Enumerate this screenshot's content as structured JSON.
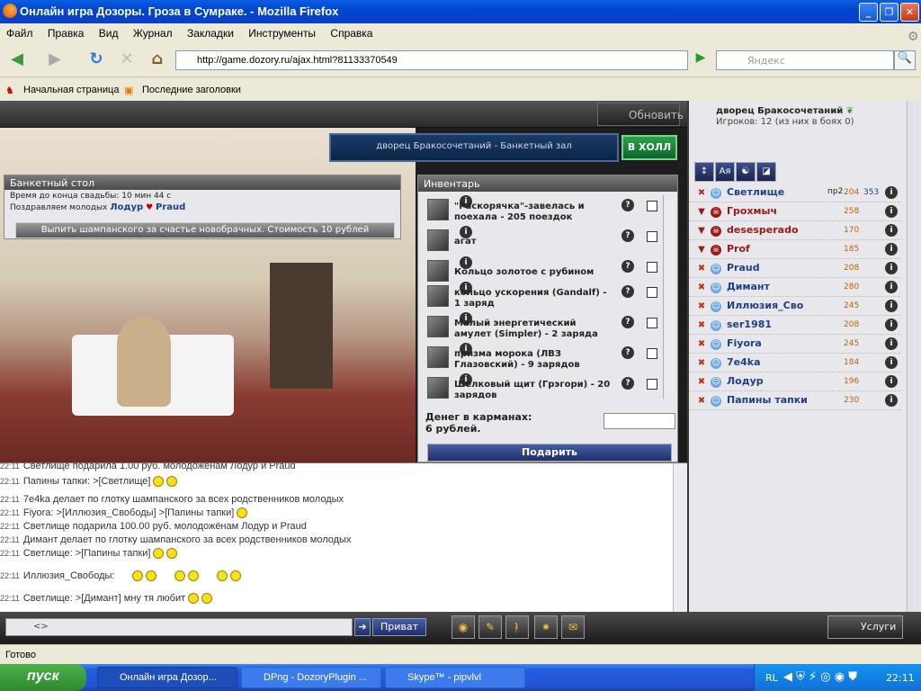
{
  "window": {
    "title": "Онлайн игра Дозоры. Гроза в Сумраке. - Mozilla Firefox"
  },
  "menu": [
    "Файл",
    "Правка",
    "Вид",
    "Журнал",
    "Закладки",
    "Инструменты",
    "Справка"
  ],
  "nav": {
    "url": "http://game.dozory.ru/ajax.html?81133370549",
    "search_placeholder": "Яндекс",
    "search_engine": "Я"
  },
  "bookmarks": [
    "Начальная страница",
    "Последние заголовки"
  ],
  "game": {
    "refresh_label": "Обновить",
    "room_title": "дворец Бракосочетаний - Банкетный зал",
    "to_hall": "В ХОЛЛ",
    "banquet": {
      "header": "Банкетный стол",
      "time_left": "Время до конца свадьбы: 10 мин 44 с",
      "congrats_prefix": "Поздравляем молодых",
      "groom": "Лодур",
      "bride": "Praud",
      "button": "Выпить шампанского за счастье новобрачных. Стоимость 10 рублей"
    },
    "inventory": {
      "header": "Инвентарь",
      "items": [
        "\"Раскорячка\"-завелась и поехала - 205 поездок",
        "агат",
        "Кольцо золотое с рубином",
        "кольцо ускорения (Gandalf) - 1 заряд",
        "Малый энергетический амулет (Simpler) - 2 заряда",
        "призма морока (ЛВЗ Глазовский) - 9 зарядов",
        "Шелковый щит (Грэгори) - 20 зарядов"
      ],
      "money_label": "Денег в карманах:",
      "money_value": "6 рублей.",
      "give_button": "Подарить"
    },
    "room_panel": {
      "name": "дворец Бракосочетаний",
      "players": "Игроков: 12 (из них в боях 0)",
      "filters": [
        "↕",
        "Ая",
        "☯",
        "◪"
      ]
    },
    "players": [
      {
        "name": "Светлище",
        "extra": "пр2",
        "level": "204",
        "level2": "353",
        "side": "light"
      },
      {
        "name": "Грохмыч",
        "extra": "",
        "level": "258",
        "level2": "",
        "side": "dark"
      },
      {
        "name": "desesperado",
        "extra": "",
        "level": "170",
        "level2": "",
        "side": "dark"
      },
      {
        "name": "Prof",
        "extra": "",
        "level": "185",
        "level2": "",
        "side": "dark"
      },
      {
        "name": "Praud",
        "extra": "",
        "level": "208",
        "level2": "",
        "side": "light"
      },
      {
        "name": "Димант",
        "extra": "",
        "level": "280",
        "level2": "",
        "side": "light"
      },
      {
        "name": "Иллюзия_Сво",
        "extra": "",
        "level": "245",
        "level2": "",
        "side": "light"
      },
      {
        "name": "ser1981",
        "extra": "",
        "level": "208",
        "level2": "",
        "side": "light"
      },
      {
        "name": "Fiyora",
        "extra": "",
        "level": "245",
        "level2": "",
        "side": "light"
      },
      {
        "name": "7e4ka",
        "extra": "",
        "level": "184",
        "level2": "",
        "side": "light"
      },
      {
        "name": "Лодур",
        "extra": "",
        "level": "196",
        "level2": "",
        "side": "light"
      },
      {
        "name": "Папины тапки",
        "extra": "",
        "level": "230",
        "level2": "",
        "side": "light"
      }
    ],
    "chat": [
      {
        "time": "22:11",
        "text": "Светлище подарила 1.00 руб. молодожёнам Лодур и Praud"
      },
      {
        "time": "22:11",
        "text": "Папины тапки: >[Светлище]"
      },
      {
        "time": "22:11",
        "text": "7e4ka делает по глотку шампанского за всех родственников молодых"
      },
      {
        "time": "22:11",
        "text": "Fiyora: >[Иллюзия_Свободы] >[Папины тапки]"
      },
      {
        "time": "22:11",
        "text": "Светлище подарила 100.00 руб. молодожёнам Лодур и Praud"
      },
      {
        "time": "22:11",
        "text": "Димант делает по глотку шампанского за всех родственников молодых"
      },
      {
        "time": "22:11",
        "text": "Светлище: >[Папины тапки]"
      },
      {
        "time": "22:11",
        "text": "Иллюзия_Свободы:"
      },
      {
        "time": "22:11",
        "text": "Светлище: >[Димант]  мну тя любит"
      }
    ],
    "chat_input": "<>",
    "private_button": "Приват",
    "services": "Услуги"
  },
  "status": "Готово",
  "taskbar": {
    "start": "пуск",
    "tasks": [
      "Онлайн игра Дозор...",
      "DPng - DozoryPlugin ...",
      "Skype™ - pipvlvl"
    ],
    "lang": "RL",
    "clock": "22:11"
  }
}
